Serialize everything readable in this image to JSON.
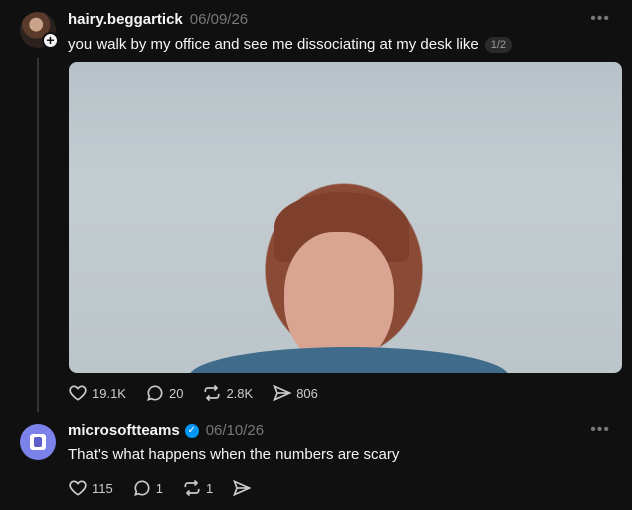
{
  "posts": [
    {
      "username": "hairy.beggartick",
      "date": "06/09/26",
      "text": "you walk by my office and see me dissociating at my desk like",
      "page_counter": "1/2",
      "actions": {
        "likes": "19.1K",
        "replies": "20",
        "reposts": "2.8K",
        "shares": "806"
      }
    },
    {
      "username": "microsoftteams",
      "verified": true,
      "date": "06/10/26",
      "text": "That's what happens when the numbers are scary",
      "actions": {
        "likes": "115",
        "replies": "1",
        "reposts": "1"
      }
    }
  ],
  "more_icon": "more-horizontal-icon",
  "colors": {
    "background": "#101010",
    "text": "#f3f5f7",
    "muted": "#777777",
    "verified": "#0095f6",
    "teams": "#7b83eb"
  }
}
